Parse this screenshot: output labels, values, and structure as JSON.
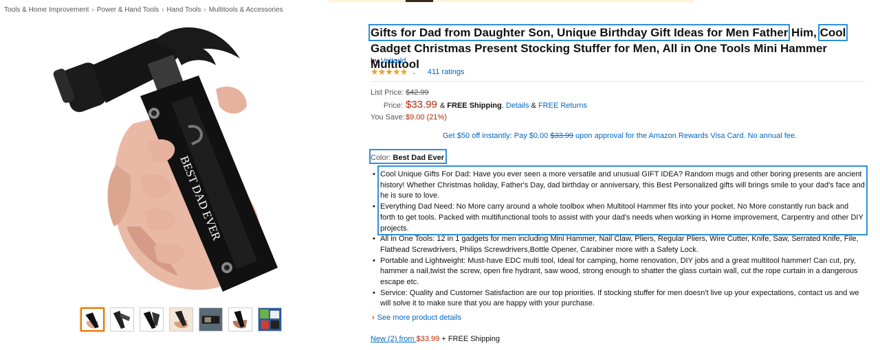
{
  "breadcrumb": [
    "Tools & Home Improvement",
    "Power & Hand Tools",
    "Hand Tools",
    "Multitools & Accessories"
  ],
  "product": {
    "title_part1": "Gifts for Dad from Daughter Son, Unique Birthday Gift Ideas for Men Father",
    "title_part2": " Him, ",
    "title_part3": "Cool",
    "title_part4": " Gadget Christmas Present Stocking Stuffer for Men, All in One Tools Mini Hammer Multitool",
    "by_label": "by ",
    "brand": "Veitorld",
    "stars": "★★★★★",
    "ratings": "411 ratings",
    "image_engraving": "BEST DAD EVER"
  },
  "price": {
    "list_label": "List Price:",
    "list_value": "$42.99",
    "price_label": "Price:",
    "price_value": "$33.99",
    "amp": "&",
    "free_shipping": "FREE Shipping",
    "details": "Details",
    "free_returns": "FREE Returns",
    "save_label": "You Save:",
    "save_value": "$9.00 (21%)"
  },
  "promo": {
    "pre": "Get $50 off instantly: Pay $0.00 ",
    "strike": "$33.99",
    "post": " upon approval for the Amazon Rewards Visa Card. No annual fee."
  },
  "color": {
    "label": "Color: ",
    "value": "Best Dad Ever"
  },
  "features": [
    "Cool Unique Gifts For Dad: Have you ever seen a more versatile and unusual GIFT IDEA? Random mugs and other boring presents are ancient history! Whether Christmas holiday, Father's Day, dad birthday or anniversary, this Best Personalized gifts will brings smile to your dad's face and he is sure to love.",
    "Everything Dad Need: No More carry around a whole toolbox when Multitool Hammer fits into your pocket. No More constantly run back and forth to get tools. Packed with multifunctional tools to assist with your dad's needs when working in Home improvement, Carpentry and other DIY projects.",
    "All in One Tools: 12 in 1 gadgets for men including Mini Hammer, Nail Claw, Pliers, Regular Pliers, Wire Cutter, Knife, Saw, Serrated Knife, File, Flathead Screwdrivers, Philips Screwdrivers,Bottle Opener, Carabiner more with a Safety Lock.",
    "Portable and Lightweight: Must-have EDC multi tool, Ideal for camping, home renovation, DIY jobs and a great multitool hammer! Can cut, pry, hammer a nail,twist the screw, open fire hydrant, saw wood, strong enough to shatter the glass curtain wall, cut the rope curtain in a dangerous escape etc.",
    "Service: Quality and Customer Satisfaction are our top priorities. If stocking stuffer for men doesn't live up your expectations, contact us and we will solve it to make sure that you are happy with your purchase."
  ],
  "see_more": "See more product details",
  "new_from": {
    "label": "New (2) from ",
    "price": "$33.99",
    "shipping": " + FREE Shipping"
  },
  "colors": {
    "link": "#0066c0",
    "price": "#b12704",
    "highlight": "#2d8fd9",
    "star": "#f0a01a"
  }
}
